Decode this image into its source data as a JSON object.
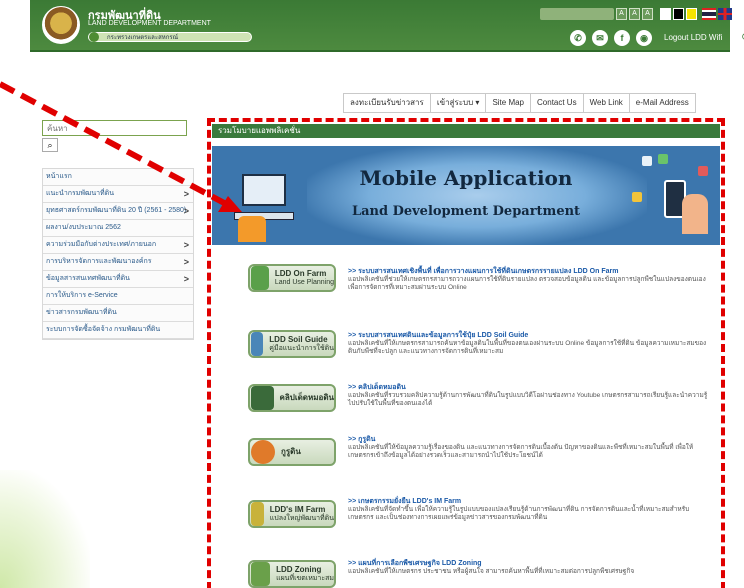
{
  "header": {
    "title_th": "กรมพัฒนาที่ดิน",
    "title_en": "LAND DEVELOPMENT DEPARTMENT",
    "pill_text": "กระทรวงเกษตรและสหกรณ์",
    "font_sizes": [
      "A",
      "A",
      "A"
    ],
    "social": [
      "✆",
      "✉",
      "f",
      "◉"
    ],
    "logout_label": "Logout LDD Wifi",
    "colors": {
      "brand_green": "#3b7a35",
      "accent_blue": "#3c76ad",
      "annotation_red": "#e00000"
    }
  },
  "toplinks": [
    "ลงทะเบียนรับข่าวสาร",
    "เข้าสู่ระบบ ▾",
    "Site Map",
    "Contact Us",
    "Web Link",
    "e-Mail Address"
  ],
  "sidebar": {
    "search_placeholder": "ค้นหา",
    "search_icon": "search-icon",
    "items": [
      {
        "label": "หน้าแรก",
        "chevron": ""
      },
      {
        "label": "แนะนำกรมพัฒนาที่ดิน",
        "chevron": ">"
      },
      {
        "label": "ยุทธศาสตร์กรมพัฒนาที่ดิน 20 ปี (2561 - 2580)",
        "chevron": ">"
      },
      {
        "label": "ผลงาน/งบประมาณ 2562",
        "chevron": ""
      },
      {
        "label": "ความร่วมมือกับต่างประเทศ/ภายนอก",
        "chevron": ">"
      },
      {
        "label": "การบริหารจัดการและพัฒนาองค์กร",
        "chevron": ">"
      },
      {
        "label": "ข้อมูลสารสนเทศพัฒนาที่ดิน",
        "chevron": ">"
      },
      {
        "label": "การให้บริการ e-Service",
        "chevron": ""
      },
      {
        "label": "ข่าวสารกรมพัฒนาที่ดิน",
        "chevron": ""
      },
      {
        "label": "ระบบการจัดซื้อจัดจ้าง กรมพัฒนาที่ดิน",
        "chevron": ""
      }
    ]
  },
  "main": {
    "panel_title": "รวมโมบายแอพพลิเคชั่น",
    "banner_title": "Mobile Application",
    "banner_subtitle": "Land Development Department",
    "apps": [
      {
        "btn_label": "LDD On Farm",
        "btn_sub": "Land Use Planning",
        "title": ">> ระบบสารสนเทศเชิงพื้นที่ เพื่อการวางแผนการใช้ที่ดินเกษตรกรรายแปลง LDD On Farm",
        "desc": "แอปพลิเคชันที่ช่วยให้เกษตรกรสามารถวางแผนการใช้ที่ดินรายแปลง ตรวจสอบข้อมูลดิน และข้อมูลการปลูกพืชในแปลงของตนเอง เพื่อการจัดการที่เหมาะสมผ่านระบบ Online",
        "thumb": "#5aa04a"
      },
      {
        "btn_label": "LDD Soil Guide",
        "btn_sub": "คู่มือแนะนำการใช้ดิน",
        "title": ">> ระบบสารสนเทศดินและข้อมูลการใช้ปุ๋ย LDD Soil Guide",
        "desc": "แอปพลิเคชันที่ให้เกษตรกรสามารถค้นหาข้อมูลดินในพื้นที่ของตนเองผ่านระบบ Online ข้อมูลการใช้ที่ดิน ข้อมูลความเหมาะสมของดินกับพืชที่จะปลูก และแนวทางการจัดการดินที่เหมาะสม",
        "thumb": "#4a86b8"
      },
      {
        "btn_label": "คลิปเด็ดหมอดิน",
        "btn_sub": "",
        "title": ">> คลิปเด็ดหมอดิน",
        "desc": "แอปพลิเคชันที่รวบรวมคลิปความรู้ด้านการพัฒนาที่ดินในรูปแบบวิดีโอผ่านช่องทาง Youtube เกษตรกรสามารถเรียนรู้และนำความรู้ไปปรับใช้ในพื้นที่ของตนเองได้",
        "thumb": "#3a6a3a"
      },
      {
        "btn_label": "กูรูดิน",
        "btn_sub": "",
        "title": ">> กูรูดิน",
        "desc": "แอปพลิเคชันที่ให้ข้อมูลความรู้เรื่องของดิน และแนวทางการจัดการดินเบื้องต้น ปัญหาของดินและพืชที่เหมาะสมในพื้นที่ เพื่อให้เกษตรกรเข้าถึงข้อมูลได้อย่างรวดเร็วและสามารถนำไปใช้ประโยชน์ได้",
        "thumb": "#e07a2a"
      },
      {
        "btn_label": "LDD's IM Farm",
        "btn_sub": "แปลงใหญ่พัฒนาที่ดิน",
        "title": ">> เกษตรกรรมยั่งยืน LDD's IM Farm",
        "desc": "แอปพลิเคชันที่จัดทำขึ้น เพื่อให้ความรู้ในรูปแบบของแปลงเรียนรู้ด้านการพัฒนาที่ดิน การจัดการดินและน้ำที่เหมาะสมสำหรับเกษตรกร และเป็นช่องทางการเผยแพร่ข้อมูลข่าวสารของกรมพัฒนาที่ดิน",
        "thumb": "#c8b23a"
      },
      {
        "btn_label": "LDD Zoning",
        "btn_sub": "แผนที่เขตเหมาะสม",
        "title": ">> แผนที่การเลือกพืชเศรษฐกิจ LDD Zoning",
        "desc": "แอปพลิเคชันที่ให้เกษตรกร ประชาชน หรือผู้สนใจ สามารถค้นหาพื้นที่ที่เหมาะสมต่อการปลูกพืชเศรษฐกิจ",
        "thumb": "#6aa04a"
      }
    ]
  }
}
